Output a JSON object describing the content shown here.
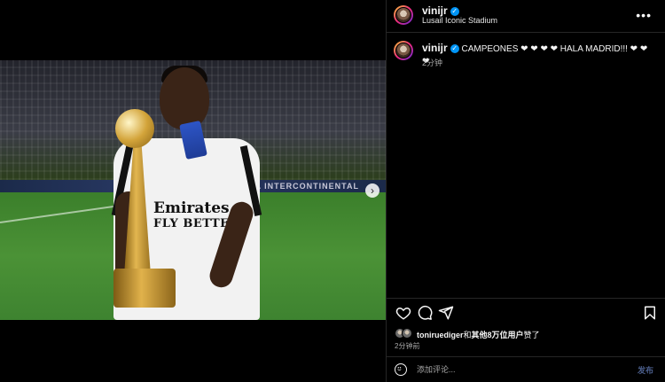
{
  "post": {
    "username": "vinijr",
    "location": "Lusail Iconic Stadium",
    "more_label": "•••"
  },
  "photo": {
    "board_text": "FIFA INTERCONTINENTAL",
    "sponsor_line1": "Emirates",
    "sponsor_line2": "FLY BETTER",
    "next_label": "›"
  },
  "caption": {
    "username": "vinijr",
    "text": "CAMPEONES ❤ ❤ ❤ ❤ HALA MADRID!!! ❤ ❤ ❤",
    "time": "2分钟"
  },
  "likes": {
    "user": "toniruediger",
    "joiner": "和",
    "others": "其他8万位用户",
    "suffix": "赞了",
    "time": "2分钟前"
  },
  "comment": {
    "placeholder": "添加评论...",
    "post_label": "发布"
  },
  "icons": {
    "like": "heart-icon",
    "comment": "comment-icon",
    "share": "send-icon",
    "save": "bookmark-icon",
    "emoji": "emoji-icon"
  }
}
